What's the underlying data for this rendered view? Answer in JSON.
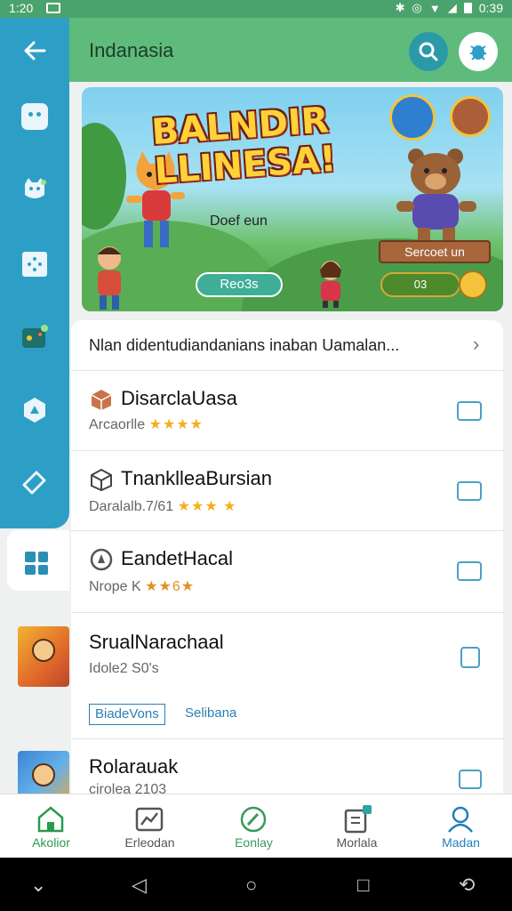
{
  "status_bar": {
    "time": "1:20",
    "right_text": "0:39",
    "icons": [
      "bluetooth-icon",
      "data-icon",
      "wifi-icon",
      "signal-icon",
      "battery-icon"
    ]
  },
  "header": {
    "title": "Indanasia",
    "search_icon": "search-icon",
    "bug_icon": "bug-icon"
  },
  "rail": {
    "items": [
      "back-arrow-icon",
      "robot-face-icon",
      "cat-face-icon",
      "dice-icon",
      "game-controller-icon",
      "tag-hexagon-icon",
      "ticket-icon",
      "grid-icon"
    ]
  },
  "banner": {
    "title_line1": "BALNDIR",
    "title_line2": "LLINESA!",
    "subtitle": "Doef eun",
    "cta": "Reo3s",
    "badge": "Sercoet un",
    "score": "03"
  },
  "list": {
    "header": "Nlan didentudiandanians inaban Uamalan...",
    "items": [
      {
        "name": "DisarclaUasa",
        "meta": "Arcaorlle",
        "stars": "★★★★"
      },
      {
        "name": "TnanklleaBursian",
        "meta": "Daralalb.7/61",
        "stars": "★★★ ★"
      },
      {
        "name": "EandetHacal",
        "meta": "Nrope K",
        "stars": "★★6★"
      },
      {
        "name": "SrualNarachaal",
        "meta": "Idole2 S0's",
        "stars": ""
      },
      {
        "name": "Rolarauak",
        "meta": "cirolea 2103",
        "stars": ""
      }
    ],
    "tag_link": "BiadeVons",
    "tag_text": "Selibana"
  },
  "bottom_nav": [
    {
      "label": "Akolior",
      "icon": "home-icon"
    },
    {
      "label": "Erleodan",
      "icon": "chart-icon"
    },
    {
      "label": "Eonlay",
      "icon": "compass-icon"
    },
    {
      "label": "Morlala",
      "icon": "document-icon"
    },
    {
      "label": "Madan",
      "icon": "person-icon"
    }
  ],
  "colors": {
    "accent": "#5fbb7c",
    "rail": "#2d9fc6",
    "active_nav": "#2a9a4f",
    "profile_nav": "#1f7fb8"
  }
}
